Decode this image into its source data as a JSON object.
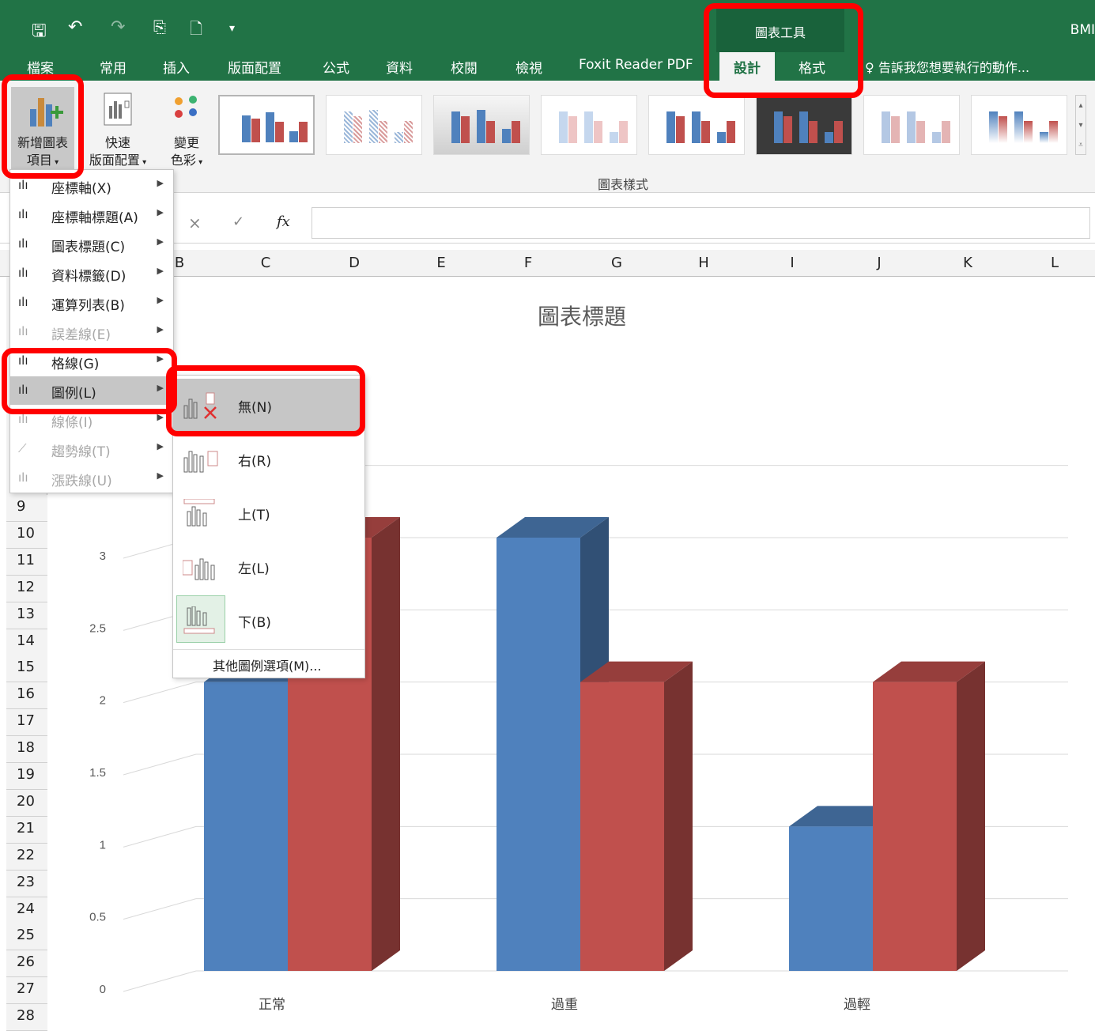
{
  "window": {
    "title": "BMI",
    "context_group": "圖表工具"
  },
  "qat": {
    "save": "🖫",
    "undo": "↶",
    "redo": "↷"
  },
  "tabs": [
    {
      "label": "檔案"
    },
    {
      "label": "常用"
    },
    {
      "label": "插入"
    },
    {
      "label": "版面配置"
    },
    {
      "label": "公式"
    },
    {
      "label": "資料"
    },
    {
      "label": "校閱"
    },
    {
      "label": "檢視"
    },
    {
      "label": "Foxit Reader PDF"
    },
    {
      "label": "設計"
    },
    {
      "label": "格式"
    }
  ],
  "tell_me": "告訴我您想要執行的動作...",
  "ribbon": {
    "add_element": "新增圖表\n項目",
    "add_element_l1": "新增圖表",
    "add_element_l2": "項目",
    "quick_layout_l1": "快速",
    "quick_layout_l2": "版面配置",
    "change_colors_l1": "變更",
    "change_colors_l2": "色彩",
    "styles_group": "圖表樣式"
  },
  "formula_bar": {
    "cancel": "×",
    "enter": "✓",
    "fx": "fx"
  },
  "columns": [
    "B",
    "C",
    "D",
    "E",
    "F",
    "G",
    "H",
    "I",
    "J",
    "K",
    "L"
  ],
  "rows": [
    "9",
    "10",
    "11",
    "12",
    "13",
    "14",
    "15",
    "16",
    "17",
    "18",
    "19",
    "20",
    "21",
    "22",
    "23",
    "24",
    "25",
    "26",
    "27",
    "28"
  ],
  "menu": {
    "items": [
      {
        "label": "座標軸(X)",
        "icon": "axes-icon",
        "disabled": false
      },
      {
        "label": "座標軸標題(A)",
        "icon": "axis-titles-icon",
        "disabled": false
      },
      {
        "label": "圖表標題(C)",
        "icon": "chart-title-icon",
        "disabled": false
      },
      {
        "label": "資料標籤(D)",
        "icon": "data-labels-icon",
        "disabled": false
      },
      {
        "label": "運算列表(B)",
        "icon": "data-table-icon",
        "disabled": false
      },
      {
        "label": "誤差線(E)",
        "icon": "error-bars-icon",
        "disabled": true
      },
      {
        "label": "格線(G)",
        "icon": "gridlines-icon",
        "disabled": false
      },
      {
        "label": "圖例(L)",
        "icon": "legend-icon",
        "disabled": false
      },
      {
        "label": "線條(I)",
        "icon": "lines-icon",
        "disabled": true
      },
      {
        "label": "趨勢線(T)",
        "icon": "trendline-icon",
        "disabled": true
      },
      {
        "label": "漲跌線(U)",
        "icon": "updown-bars-icon",
        "disabled": true
      }
    ]
  },
  "legend_submenu": {
    "items": [
      {
        "label": "無(N)"
      },
      {
        "label": "右(R)"
      },
      {
        "label": "上(T)"
      },
      {
        "label": "左(L)"
      },
      {
        "label": "下(B)"
      }
    ],
    "more": "其他圖例選項(M)..."
  },
  "chart_data": {
    "type": "bar",
    "title": "圖表標題",
    "categories": [
      "正常",
      "過重",
      "過輕"
    ],
    "series": [
      {
        "values": [
          2,
          3,
          1
        ],
        "color": "#4f81bd"
      },
      {
        "values": [
          3,
          2,
          2
        ],
        "color": "#c0504d"
      }
    ],
    "yticks": [
      "0",
      "0.5",
      "1",
      "1.5",
      "2",
      "2.5",
      "3"
    ],
    "ylim": [
      0,
      3.5
    ],
    "grid": true,
    "style": "3d-clustered-column"
  }
}
